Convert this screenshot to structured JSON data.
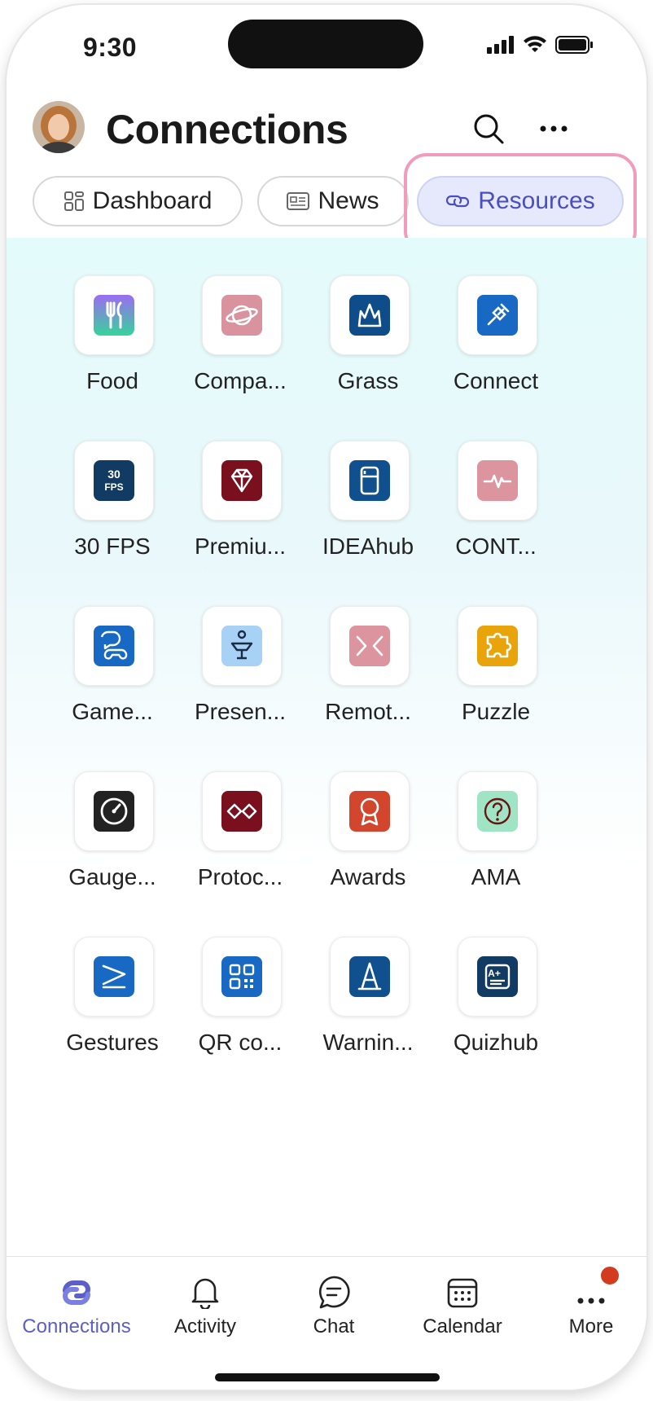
{
  "status": {
    "time": "9:30"
  },
  "header": {
    "title": "Connections"
  },
  "tabs": [
    {
      "label": "Dashboard",
      "icon": "dashboard-icon",
      "active": false
    },
    {
      "label": "News",
      "icon": "news-icon",
      "active": false
    },
    {
      "label": "Resources",
      "icon": "link-icon",
      "active": true
    }
  ],
  "apps": [
    {
      "label": "Food",
      "icon": "fork-knife-icon",
      "color": "#8b7cf6"
    },
    {
      "label": "Compa...",
      "icon": "planet-icon",
      "color": "#d9939f"
    },
    {
      "label": "Grass",
      "icon": "grass-icon",
      "color": "#0f4c8a"
    },
    {
      "label": "Connect",
      "icon": "plug-icon",
      "color": "#1769c4"
    },
    {
      "label": "30 FPS",
      "icon": "fps-icon",
      "color": "#123b63"
    },
    {
      "label": "Premiu...",
      "icon": "diamond-icon",
      "color": "#7a0f1e"
    },
    {
      "label": "IDEAhub",
      "icon": "fridge-icon",
      "color": "#10508e"
    },
    {
      "label": "CONT...",
      "icon": "pulse-icon",
      "color": "#dc949f"
    },
    {
      "label": "Game...",
      "icon": "gamepad-chat-icon",
      "color": "#1769c4"
    },
    {
      "label": "Presen...",
      "icon": "presenter-icon",
      "color": "#a8d1f6"
    },
    {
      "label": "Remot...",
      "icon": "remote-icon",
      "color": "#dc949f"
    },
    {
      "label": "Puzzle",
      "icon": "puzzle-icon",
      "color": "#e9a30b"
    },
    {
      "label": "Gauge...",
      "icon": "gauge-icon",
      "color": "#222222"
    },
    {
      "label": "Protoc...",
      "icon": "protocol-icon",
      "color": "#7a0f1e"
    },
    {
      "label": "Awards",
      "icon": "award-icon",
      "color": "#d2462d"
    },
    {
      "label": "AMA",
      "icon": "question-icon",
      "color": "#9fe5c5"
    },
    {
      "label": "Gestures",
      "icon": "gesture-icon",
      "color": "#1769c4"
    },
    {
      "label": "QR co...",
      "icon": "qr-icon",
      "color": "#1769c4"
    },
    {
      "label": "Warnin...",
      "icon": "warning-cone-icon",
      "color": "#10508e"
    },
    {
      "label": "Quizhub",
      "icon": "quiz-icon",
      "color": "#123b63"
    }
  ],
  "nav": [
    {
      "label": "Connections",
      "icon": "connections-icon",
      "active": true
    },
    {
      "label": "Activity",
      "icon": "bell-icon",
      "active": false
    },
    {
      "label": "Chat",
      "icon": "chat-icon",
      "active": false
    },
    {
      "label": "Calendar",
      "icon": "calendar-icon",
      "active": false
    },
    {
      "label": "More",
      "icon": "more-icon",
      "active": false,
      "badge": true
    }
  ],
  "colors": {
    "accent": "#5b5fc7",
    "highlight_border": "#f19cbb",
    "badge": "#d33b1f"
  }
}
